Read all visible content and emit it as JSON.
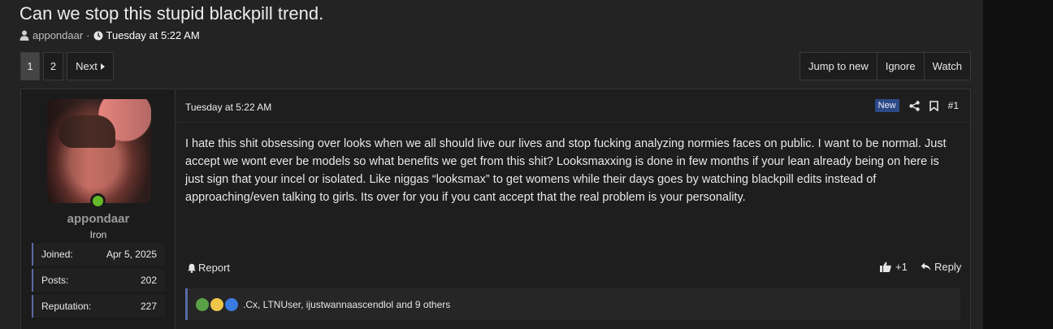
{
  "thread": {
    "title": "Can we stop this stupid blackpill trend.",
    "author": "appondaar",
    "separator": "·",
    "date": "Tuesday at 5:22 AM"
  },
  "pagination": {
    "current": "1",
    "page2": "2",
    "next_label": "Next"
  },
  "thread_actions": {
    "jump": "Jump to new",
    "ignore": "Ignore",
    "watch": "Watch"
  },
  "post": {
    "user": {
      "name": "appondaar",
      "title": "Iron",
      "online": true,
      "stats": [
        {
          "label": "Joined:",
          "value": "Apr 5, 2025"
        },
        {
          "label": "Posts:",
          "value": "202"
        },
        {
          "label": "Reputation:",
          "value": "227"
        }
      ]
    },
    "date": "Tuesday at 5:22 AM",
    "badge": "New",
    "number": "#1",
    "body": "I hate this shit obsessing over looks when we all should live our lives and stop fucking analyzing normies faces on public. I want to be normal. Just accept we wont ever be models so what benefits we get from this shit? Looksmaxxing is done in few months if your lean already being on here is just sign that your incel or isolated. Like niggas “looksmax” to get womens while their days goes by watching blackpill edits instead of approaching/even talking to girls. Its over for you if you cant accept that the real problem is your personality.",
    "report_label": "Report",
    "like_label": "+1",
    "reply_label": "Reply",
    "reactions_text": ".Cx, LTNUser, ijustwannaascendlol and 9 others"
  },
  "colors": {
    "accent": "#5a6aa6",
    "online": "#63b829",
    "new_badge": "#2d4a87"
  }
}
